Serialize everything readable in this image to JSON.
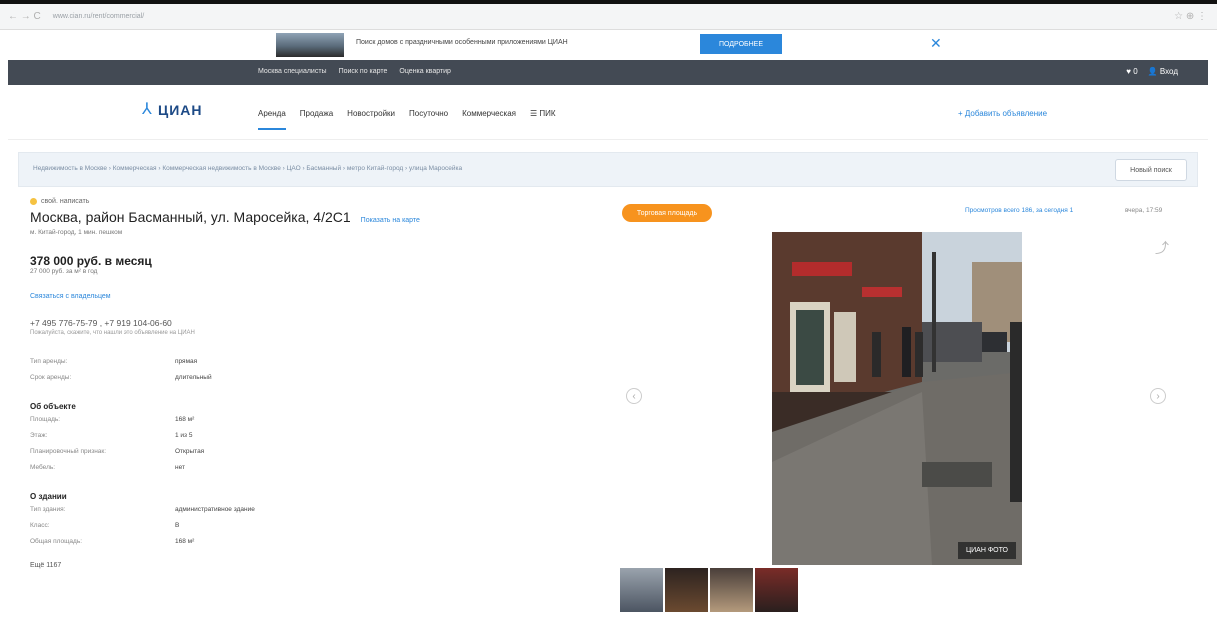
{
  "browser": {
    "nav": "← → C",
    "url": "www.cian.ru/rent/commercial/",
    "right_icons": "☆ ⊕ ⋮"
  },
  "promo": {
    "text": "Поиск домов с праздничными особенными приложениями ЦИАН",
    "button": "ПОДРОБНЕЕ",
    "close": "✕"
  },
  "topnav": {
    "links": [
      "Москва специалисты",
      "Поиск по карте",
      "Оценка квартир"
    ],
    "right": [
      "♥ 0",
      "👤 Вход"
    ]
  },
  "header": {
    "logo": "ЦИАН",
    "menu": [
      "Аренда",
      "Продажа",
      "Новостройки",
      "Посуточно",
      "Коммерческая",
      "☰ ПИК"
    ],
    "add_link": "+ Добавить объявление"
  },
  "breadcrumbs": {
    "trail": "Недвижимость в Москве › Коммерческая › Коммерческая недвижимость в Москве › ЦАО › Басманный › метро Китай-город › улица Маросейка",
    "new_search": "Новый поиск"
  },
  "listing": {
    "tag": "свой. написать",
    "title": "Москва, район Басманный, ул. Маросейка, 4/2С1",
    "map_link": "Показать на карте",
    "metro": "м. Китай-город, 1 мин. пешком",
    "price": "378 000 руб. в месяц",
    "price_sub": "27 000 руб. за м² в год",
    "owner_link": "Связаться с владельцем",
    "phones": "+7 495 776-75-79 , +7 919 104-06-60",
    "phone_note": "Пожалуйста, скажите, что нашли это объявление на ЦИАН",
    "rows_main": [
      {
        "k": "Тип аренды:",
        "v": "прямая"
      },
      {
        "k": "Срок аренды:",
        "v": "длительный"
      }
    ],
    "section_object": "Об объекте",
    "rows_object": [
      {
        "k": "Площадь:",
        "v": "168 м²"
      },
      {
        "k": "Этаж:",
        "v": "1 из 5"
      },
      {
        "k": "Планировочный признак:",
        "v": "Открытая"
      },
      {
        "k": "Мебель:",
        "v": "нет"
      }
    ],
    "section_building": "О здании",
    "rows_building": [
      {
        "k": "Тип здания:",
        "v": "административное здание"
      },
      {
        "k": "Класс:",
        "v": "B"
      },
      {
        "k": "Общая площадь:",
        "v": "168 м²"
      }
    ],
    "more": "Ещё 1167"
  },
  "gallery": {
    "badge": "Торговая площадь",
    "views": "Просмотров всего 186, за сегодня 1",
    "views_date": "вчера, 17:59",
    "watermark": "ЦИАН  ФОТО",
    "prev": "‹",
    "next": "›",
    "share": "⤴"
  }
}
